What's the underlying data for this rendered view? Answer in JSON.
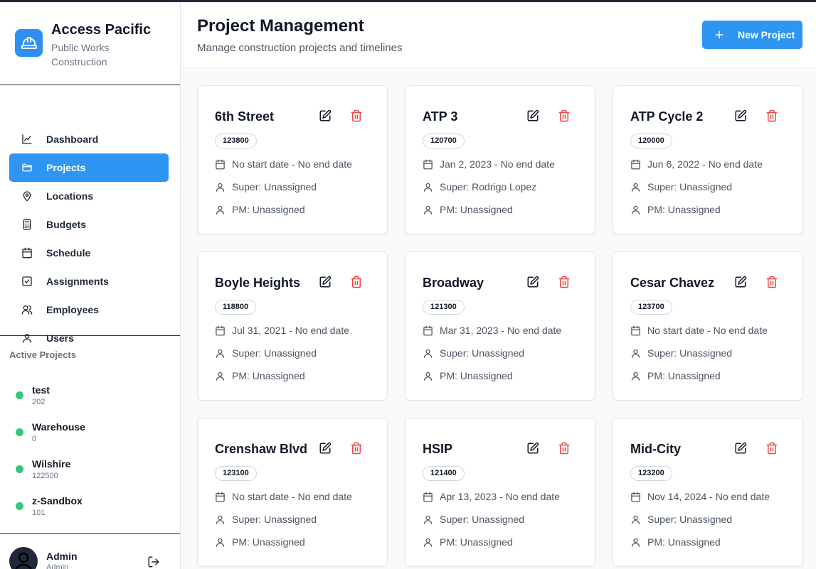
{
  "brand": {
    "name": "Access Pacific",
    "subtitle": "Public Works Construction"
  },
  "nav": [
    {
      "label": "Dashboard",
      "icon": "chart-line-icon",
      "active": false
    },
    {
      "label": "Projects",
      "icon": "folder-icon",
      "active": true
    },
    {
      "label": "Locations",
      "icon": "map-pin-icon",
      "active": false
    },
    {
      "label": "Budgets",
      "icon": "calculator-icon",
      "active": false
    },
    {
      "label": "Schedule",
      "icon": "calendar-icon",
      "active": false
    },
    {
      "label": "Assignments",
      "icon": "checkbox-icon",
      "active": false
    },
    {
      "label": "Employees",
      "icon": "users-icon",
      "active": false
    },
    {
      "label": "Users",
      "icon": "user-icon",
      "active": false
    }
  ],
  "active_projects": {
    "title": "Active Projects",
    "items": [
      {
        "name": "test",
        "number": "202",
        "status_color": "#34c77b"
      },
      {
        "name": "Warehouse",
        "number": "0",
        "status_color": "#34c77b"
      },
      {
        "name": "Wilshire",
        "number": "122500",
        "status_color": "#34c77b"
      },
      {
        "name": "z-Sandbox",
        "number": "101",
        "status_color": "#34c77b"
      }
    ]
  },
  "user": {
    "name": "Admin",
    "role": "Admin"
  },
  "header": {
    "title": "Project Management",
    "subtitle": "Manage construction projects and timelines",
    "new_button": "New Project"
  },
  "colors": {
    "accent": "#2f95f3",
    "danger": "#ef4444",
    "success": "#34c77b"
  },
  "projects": [
    {
      "name": "6th Street",
      "number": "123800",
      "dates": "No start date - No end date",
      "super": "Super: Unassigned",
      "pm": "PM: Unassigned"
    },
    {
      "name": "ATP 3",
      "number": "120700",
      "dates": "Jan 2, 2023 - No end date",
      "super": "Super: Rodrigo Lopez",
      "pm": "PM: Unassigned"
    },
    {
      "name": "ATP Cycle 2",
      "number": "120000",
      "dates": "Jun 6, 2022 - No end date",
      "super": "Super: Unassigned",
      "pm": "PM: Unassigned"
    },
    {
      "name": "Boyle Heights",
      "number": "118800",
      "dates": "Jul 31, 2021 - No end date",
      "super": "Super: Unassigned",
      "pm": "PM: Unassigned"
    },
    {
      "name": "Broadway",
      "number": "121300",
      "dates": "Mar 31, 2023 - No end date",
      "super": "Super: Unassigned",
      "pm": "PM: Unassigned"
    },
    {
      "name": "Cesar Chavez",
      "number": "123700",
      "dates": "No start date - No end date",
      "super": "Super: Unassigned",
      "pm": "PM: Unassigned"
    },
    {
      "name": "Crenshaw Blvd",
      "number": "123100",
      "dates": "No start date - No end date",
      "super": "Super: Unassigned",
      "pm": "PM: Unassigned"
    },
    {
      "name": "HSIP",
      "number": "121400",
      "dates": "Apr 13, 2023 - No end date",
      "super": "Super: Unassigned",
      "pm": "PM: Unassigned"
    },
    {
      "name": "Mid-City",
      "number": "123200",
      "dates": "Nov 14, 2024 - No end date",
      "super": "Super: Unassigned",
      "pm": "PM: Unassigned"
    }
  ]
}
